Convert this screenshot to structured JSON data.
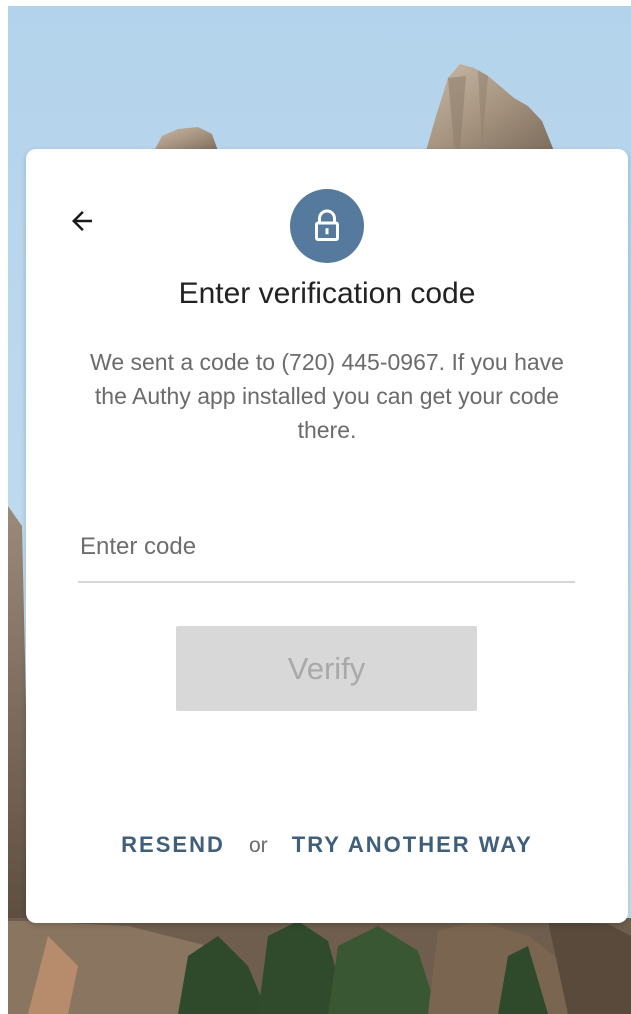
{
  "colors": {
    "accent": "#567a9e",
    "link": "#3f5f7a",
    "button_disabled_bg": "#d8d8d8",
    "button_disabled_text": "#a9a9a9",
    "sky": "#b9d6ec"
  },
  "icons": {
    "back": "arrow-left-icon",
    "lock": "lock-icon"
  },
  "card": {
    "title": "Enter verification code",
    "message": "We sent a code to (720) 445-0967. If you have the Authy app installed you can get your code there.",
    "code_input": {
      "placeholder": "Enter code",
      "value": ""
    },
    "verify_button": {
      "label": "Verify",
      "state": "disabled"
    },
    "footer": {
      "resend_label": "RESEND",
      "separator": "or",
      "try_another_label": "TRY ANOTHER WAY"
    }
  }
}
